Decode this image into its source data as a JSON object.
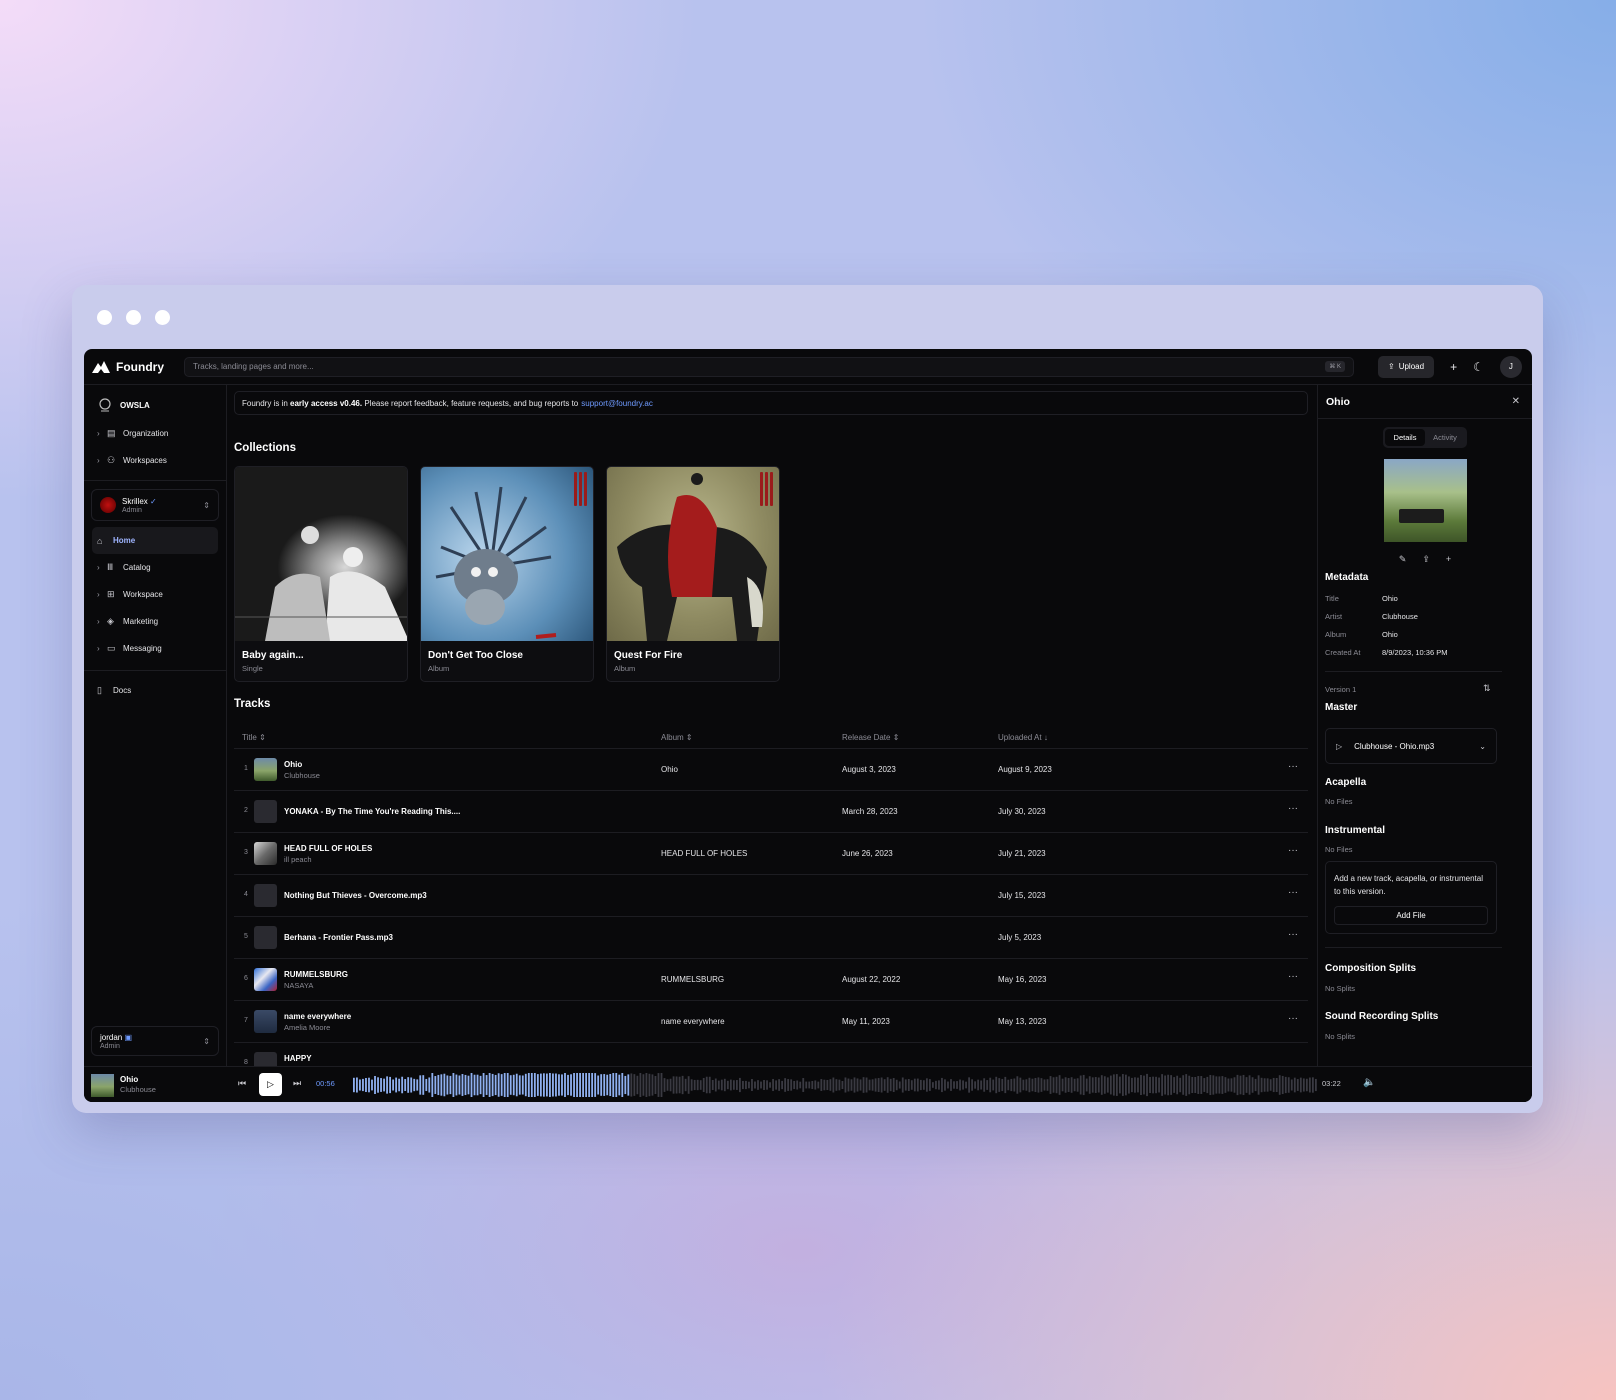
{
  "app": {
    "brand": "Foundry",
    "search_placeholder": "Tracks, landing pages and more...",
    "search_shortcut": "⌘ K",
    "upload_label": "Upload",
    "avatar_initial": "J"
  },
  "sidebar": {
    "org_name": "OWSLA",
    "top_items": [
      {
        "label": "Organization"
      },
      {
        "label": "Workspaces"
      }
    ],
    "artist": {
      "name": "Skrillex",
      "role": "Admin"
    },
    "items": [
      {
        "label": "Home"
      },
      {
        "label": "Catalog"
      },
      {
        "label": "Workspace"
      },
      {
        "label": "Marketing"
      },
      {
        "label": "Messaging"
      }
    ],
    "docs_label": "Docs",
    "user": {
      "name": "jordan",
      "role": "Admin"
    }
  },
  "banner": {
    "prefix": "Foundry is in",
    "strong": "early access v0.46.",
    "suffix": "Please report feedback, feature requests, and bug reports to",
    "link": "support@foundry.ac"
  },
  "collections": {
    "title": "Collections",
    "items": [
      {
        "title": "Baby again...",
        "type": "Single"
      },
      {
        "title": "Don't Get Too Close",
        "type": "Album"
      },
      {
        "title": "Quest For Fire",
        "type": "Album"
      }
    ]
  },
  "tracks": {
    "title": "Tracks",
    "columns": [
      "Title",
      "Album",
      "Release Date",
      "Uploaded At"
    ],
    "rows": [
      {
        "num": "1",
        "title": "Ohio",
        "artist": "Clubhouse",
        "album": "Ohio",
        "release": "August 3, 2023",
        "uploaded": "August 9, 2023"
      },
      {
        "num": "2",
        "title": "YONAKA - By The Time You're Reading This....",
        "artist": "",
        "album": "",
        "release": "March 28, 2023",
        "uploaded": "July 30, 2023"
      },
      {
        "num": "3",
        "title": "HEAD FULL OF HOLES",
        "artist": "ill peach",
        "album": "HEAD FULL OF HOLES",
        "release": "June 26, 2023",
        "uploaded": "July 21, 2023"
      },
      {
        "num": "4",
        "title": "Nothing But Thieves - Overcome.mp3",
        "artist": "",
        "album": "",
        "release": "",
        "uploaded": "July 15, 2023"
      },
      {
        "num": "5",
        "title": "Berhana - Frontier Pass.mp3",
        "artist": "",
        "album": "",
        "release": "",
        "uploaded": "July 5, 2023"
      },
      {
        "num": "6",
        "title": "RUMMELSBURG",
        "artist": "NASAYA",
        "album": "RUMMELSBURG",
        "release": "August 22, 2022",
        "uploaded": "May 16, 2023"
      },
      {
        "num": "7",
        "title": "name everywhere",
        "artist": "Amelia Moore",
        "album": "name everywhere",
        "release": "May 11, 2023",
        "uploaded": "May 13, 2023"
      },
      {
        "num": "8",
        "title": "HAPPY",
        "artist": "",
        "album": "",
        "release": "",
        "uploaded": ""
      }
    ]
  },
  "panel": {
    "title": "Ohio",
    "tabs": [
      "Details",
      "Activity"
    ],
    "metadata_title": "Metadata",
    "metadata": [
      {
        "k": "Title",
        "v": "Ohio"
      },
      {
        "k": "Artist",
        "v": "Clubhouse"
      },
      {
        "k": "Album",
        "v": "Ohio"
      },
      {
        "k": "Created At",
        "v": "8/9/2023, 10:36 PM"
      }
    ],
    "version": "Version 1",
    "master_title": "Master",
    "master_file": "Clubhouse - Ohio.mp3",
    "acapella_title": "Acapella",
    "acapella_empty": "No Files",
    "instrumental_title": "Instrumental",
    "instrumental_empty": "No Files",
    "add_text": "Add a new track, acapella, or instrumental to this version.",
    "add_button": "Add File",
    "comp_title": "Composition Splits",
    "comp_empty": "No Splits",
    "sound_title": "Sound Recording Splits",
    "sound_empty": "No Splits"
  },
  "player": {
    "title": "Ohio",
    "artist": "Clubhouse",
    "elapsed": "00:56",
    "duration": "03:22",
    "progress": 0.285
  },
  "colors": {
    "accent": "#6f9bff",
    "wave_played": "#8fb0f0",
    "wave_unplayed": "#3a3a42"
  }
}
